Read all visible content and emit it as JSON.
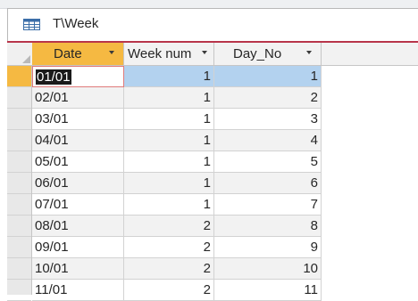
{
  "window": {
    "tab_title": "T\\Week",
    "tab_icon": "table-icon"
  },
  "table": {
    "columns": [
      {
        "label": "Date",
        "sorted": true
      },
      {
        "label": "Week num",
        "sorted": false
      },
      {
        "label": "Day_No",
        "sorted": false
      }
    ],
    "current_row_index": 0,
    "rows": [
      {
        "date": "01/01",
        "week": "1",
        "day": "1"
      },
      {
        "date": "02/01",
        "week": "1",
        "day": "2"
      },
      {
        "date": "03/01",
        "week": "1",
        "day": "3"
      },
      {
        "date": "04/01",
        "week": "1",
        "day": "4"
      },
      {
        "date": "05/01",
        "week": "1",
        "day": "5"
      },
      {
        "date": "06/01",
        "week": "1",
        "day": "6"
      },
      {
        "date": "07/01",
        "week": "1",
        "day": "7"
      },
      {
        "date": "08/01",
        "week": "2",
        "day": "8"
      },
      {
        "date": "09/01",
        "week": "2",
        "day": "9"
      },
      {
        "date": "10/01",
        "week": "2",
        "day": "10"
      },
      {
        "date": "11/01",
        "week": "2",
        "day": "11"
      }
    ]
  },
  "colors": {
    "header_active": "#f5b942",
    "selection_blue": "#b3d2ef",
    "tab_underline": "#b8354a"
  }
}
